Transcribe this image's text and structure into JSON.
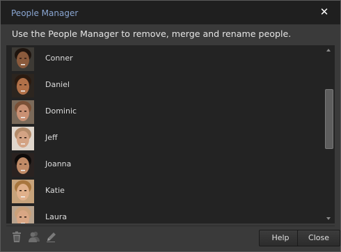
{
  "dialog": {
    "title": "People Manager",
    "close_glyph": "✕",
    "instructions": "Use the People Manager to remove, merge and rename people."
  },
  "people": [
    {
      "name": "Conner",
      "skin": "#8a5a3c",
      "hair": "#1e140e",
      "bg": "#3d3a35"
    },
    {
      "name": "Daniel",
      "skin": "#b07048",
      "hair": "#2a1a10",
      "bg": "#2c251f"
    },
    {
      "name": "Dominic",
      "skin": "#c99073",
      "hair": "#7a5036",
      "bg": "#7a6a5a"
    },
    {
      "name": "Jeff",
      "skin": "#d3a384",
      "hair": "#b38b6a",
      "bg": "#e0d6cc"
    },
    {
      "name": "Joanna",
      "skin": "#c08a66",
      "hair": "#0e0b0a",
      "bg": "#2a2220"
    },
    {
      "name": "Katie",
      "skin": "#e0b08a",
      "hair": "#a8763e",
      "bg": "#c7a37b"
    },
    {
      "name": "Laura",
      "skin": "#d9a684",
      "hair": "#caa079",
      "bg": "#b9a48f"
    }
  ],
  "toolbar": {
    "delete_icon": "trash-icon",
    "merge_icon": "merge-people-icon",
    "rename_icon": "pencil-icon"
  },
  "buttons": {
    "help": "Help",
    "close": "Close"
  }
}
